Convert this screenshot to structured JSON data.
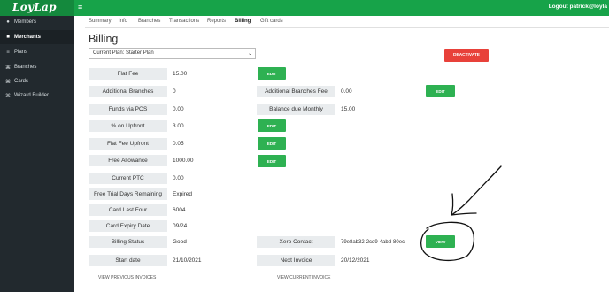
{
  "brand": {
    "logo_text": "LoyLap"
  },
  "header": {
    "menu_icon": "hamburger-icon",
    "logout_text": "Logout patrick@loyla"
  },
  "sidebar": {
    "items": [
      {
        "label": "Members",
        "icon": "user-icon"
      },
      {
        "label": "Merchants",
        "icon": "briefcase-icon",
        "active": true
      },
      {
        "label": "Plans",
        "icon": "list-icon"
      },
      {
        "label": "Branches",
        "icon": "branch-icon"
      },
      {
        "label": "Cards",
        "icon": "card-icon"
      },
      {
        "label": "Wizard Builder",
        "icon": "wand-icon"
      }
    ]
  },
  "tabs": [
    {
      "label": "Summary"
    },
    {
      "label": "Info"
    },
    {
      "label": "Branches"
    },
    {
      "label": "Transactions"
    },
    {
      "label": "Reports"
    },
    {
      "label": "Billing",
      "active": true
    },
    {
      "label": "Gift cards"
    }
  ],
  "page": {
    "title": "Billing",
    "plan_select": "Current Plan: Starter Plan",
    "deactivate_label": "DEACTIVATE"
  },
  "fields_left": [
    {
      "label": "Flat Fee",
      "value": "15.00"
    },
    {
      "label": "Additional Branches",
      "value": "0"
    },
    {
      "label": "Funds via POS",
      "value": "0.00"
    },
    {
      "label": "% on Upfront",
      "value": "3.00"
    },
    {
      "label": "Flat Fee Upfront",
      "value": "0.05"
    },
    {
      "label": "Free Allowance",
      "value": "1000.00"
    },
    {
      "label": "Current PTC",
      "value": "0.00"
    },
    {
      "label": "Free Trial Days Remaining",
      "value": "Expired"
    },
    {
      "label": "Card Last Four",
      "value": "6004"
    },
    {
      "label": "Card Expiry Date",
      "value": "09/24"
    },
    {
      "label": "Billing Status",
      "value": "Good"
    },
    {
      "label": "Start date",
      "value": "21/10/2021"
    }
  ],
  "fields_right": [
    {
      "label": "Additional Branches Fee",
      "value": "0.00"
    },
    {
      "label": "Balance due Monthly",
      "value": "15.00"
    },
    {
      "label": "Xero Contact",
      "value": "79e8ab32-2cd9-4abd-80ec"
    },
    {
      "label": "Next Invoice",
      "value": "20/12/2021"
    }
  ],
  "buttons": {
    "edit": "EDIT",
    "view": "VIEW"
  },
  "links": {
    "view_previous": "VIEW PREVIOUS INVOICES",
    "view_current": "VIEW CURRENT INVOICE"
  },
  "colors": {
    "brand_green": "#17a349",
    "button_green": "#2eb152",
    "deactivate_red": "#e8413a",
    "sidebar_bg": "#22292e"
  }
}
